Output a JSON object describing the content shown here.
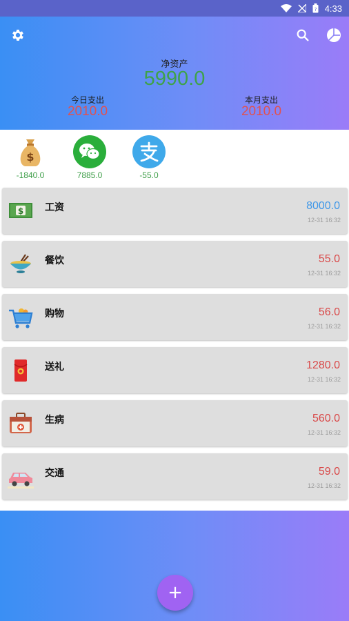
{
  "status_bar": {
    "time": "4:33",
    "icons": [
      "wifi-icon",
      "no-signal-icon",
      "battery-icon"
    ]
  },
  "header": {
    "net_assets_label": "净资产",
    "net_assets_value": "5990.0",
    "today_expense_label": "今日支出",
    "today_expense_value": "2010.0",
    "month_expense_label": "本月支出",
    "month_expense_value": "2010.0",
    "icons": [
      "settings-icon",
      "search-icon",
      "pie-chart-icon"
    ]
  },
  "accounts": [
    {
      "name": "money-bag",
      "balance": "-1840.0"
    },
    {
      "name": "wechat",
      "balance": "7885.0"
    },
    {
      "name": "alipay",
      "balance": "-55.0"
    }
  ],
  "records": [
    {
      "category": "工资",
      "amount": "8000.0",
      "time": "12-31 16:32",
      "type": "income"
    },
    {
      "category": "餐饮",
      "amount": "55.0",
      "time": "12-31 16:32",
      "type": "expense"
    },
    {
      "category": "购物",
      "amount": "56.0",
      "time": "12-31 16:32",
      "type": "expense"
    },
    {
      "category": "送礼",
      "amount": "1280.0",
      "time": "12-31 16:32",
      "type": "expense"
    },
    {
      "category": "生病",
      "amount": "560.0",
      "time": "12-31 16:32",
      "type": "expense"
    },
    {
      "category": "交通",
      "amount": "59.0",
      "time": "12-31 16:32",
      "type": "expense"
    }
  ],
  "colors": {
    "income": "#3f97e8",
    "expense": "#d94848",
    "net_assets": "#3fa24a",
    "fab": "#a063f2"
  },
  "fab": {
    "label": "+"
  }
}
